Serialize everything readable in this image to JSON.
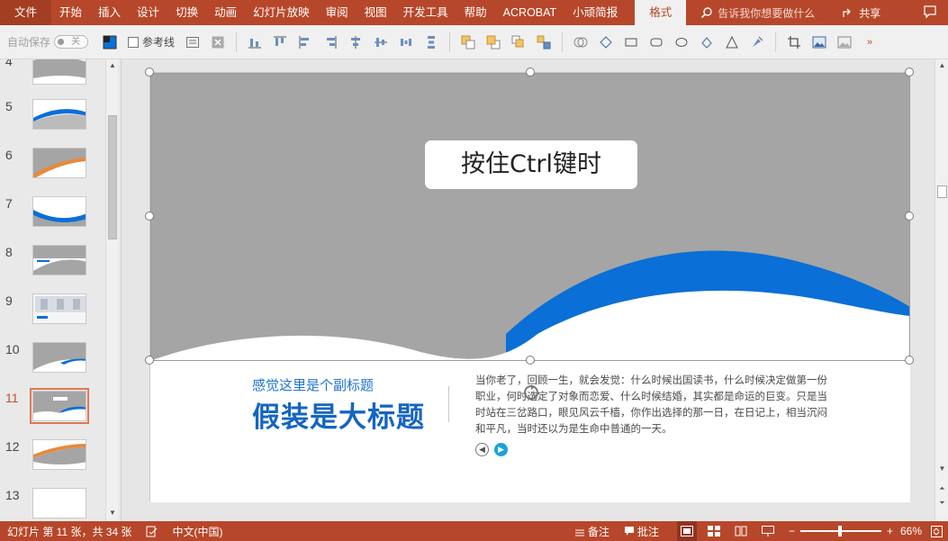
{
  "ribbon": {
    "tabs": [
      "文件",
      "开始",
      "插入",
      "设计",
      "切换",
      "动画",
      "幻灯片放映",
      "审阅",
      "视图",
      "开发工具",
      "帮助",
      "ACROBAT",
      "小顽简报",
      "格式"
    ],
    "active_tab": "格式",
    "search_placeholder": "告诉我你想要做什么",
    "share_label": "共享"
  },
  "toolbar": {
    "autosave_label": "自动保存",
    "autosave_state": "关",
    "gridline_label": "参考线"
  },
  "thumbnails": {
    "items": [
      {
        "num": "4",
        "style": "grey-top"
      },
      {
        "num": "5",
        "style": "blue-wave"
      },
      {
        "num": "6",
        "style": "orange-wave"
      },
      {
        "num": "7",
        "style": "blue-wave-low"
      },
      {
        "num": "8",
        "style": "grey-mid"
      },
      {
        "num": "9",
        "style": "photo"
      },
      {
        "num": "10",
        "style": "grey-blue"
      },
      {
        "num": "11",
        "style": "current"
      },
      {
        "num": "12",
        "style": "grey-orange"
      },
      {
        "num": "13",
        "style": "blank"
      }
    ],
    "selected": "11"
  },
  "slide": {
    "textbox_text": "按住Ctrl键时",
    "subtitle": "感觉这里是个副标题",
    "title": "假装是大标题",
    "body": "当你老了，回顾一生，就会发觉：什么时候出国读书，什么时候决定做第一份职业，何时选定了对象而恋爱、什么时候结婚，其实都是命运的巨变。只是当时站在三岔路口，眼见风云千樯，你作出选择的那一日，在日记上，相当沉闷和平凡，当时还以为是生命中普通的一天。",
    "colors": {
      "grey": "#a5a5a5",
      "blue": "#0a6fd6"
    }
  },
  "status": {
    "slide_info": "幻灯片 第 11 张，共 34 张",
    "language": "中文(中国)",
    "notes_label": "备注",
    "comments_label": "批注",
    "zoom": "66%"
  }
}
